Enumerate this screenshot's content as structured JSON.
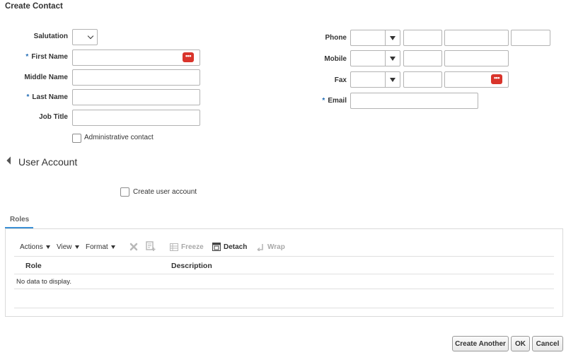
{
  "page": {
    "title": "Create Contact"
  },
  "form_left": {
    "salutation_label": "Salutation",
    "first_name_label": "First Name",
    "middle_name_label": "Middle Name",
    "last_name_label": "Last Name",
    "job_title_label": "Job Title",
    "required_marker": "*",
    "admin_contact_label": "Administrative contact"
  },
  "form_right": {
    "phone_label": "Phone",
    "mobile_label": "Mobile",
    "fax_label": "Fax",
    "email_label": "Email",
    "required_marker": "*"
  },
  "more_button_glyph": "•••",
  "user_account": {
    "section_title": "User Account",
    "create_user_account_label": "Create user account"
  },
  "tabs": [
    {
      "label": "Roles",
      "active": true
    }
  ],
  "table": {
    "toolbar": {
      "actions": "Actions",
      "view": "View",
      "format": "Format",
      "freeze": "Freeze",
      "detach": "Detach",
      "wrap": "Wrap"
    },
    "columns": [
      "Role",
      "Description"
    ],
    "empty_text": "No data to display."
  },
  "footer": {
    "create_another": "Create Another",
    "ok": "OK",
    "cancel": "Cancel"
  },
  "colors": {
    "required": "#1f6bb5",
    "more_button": "#d9342b",
    "tab_underline": "#3a8fd6"
  }
}
